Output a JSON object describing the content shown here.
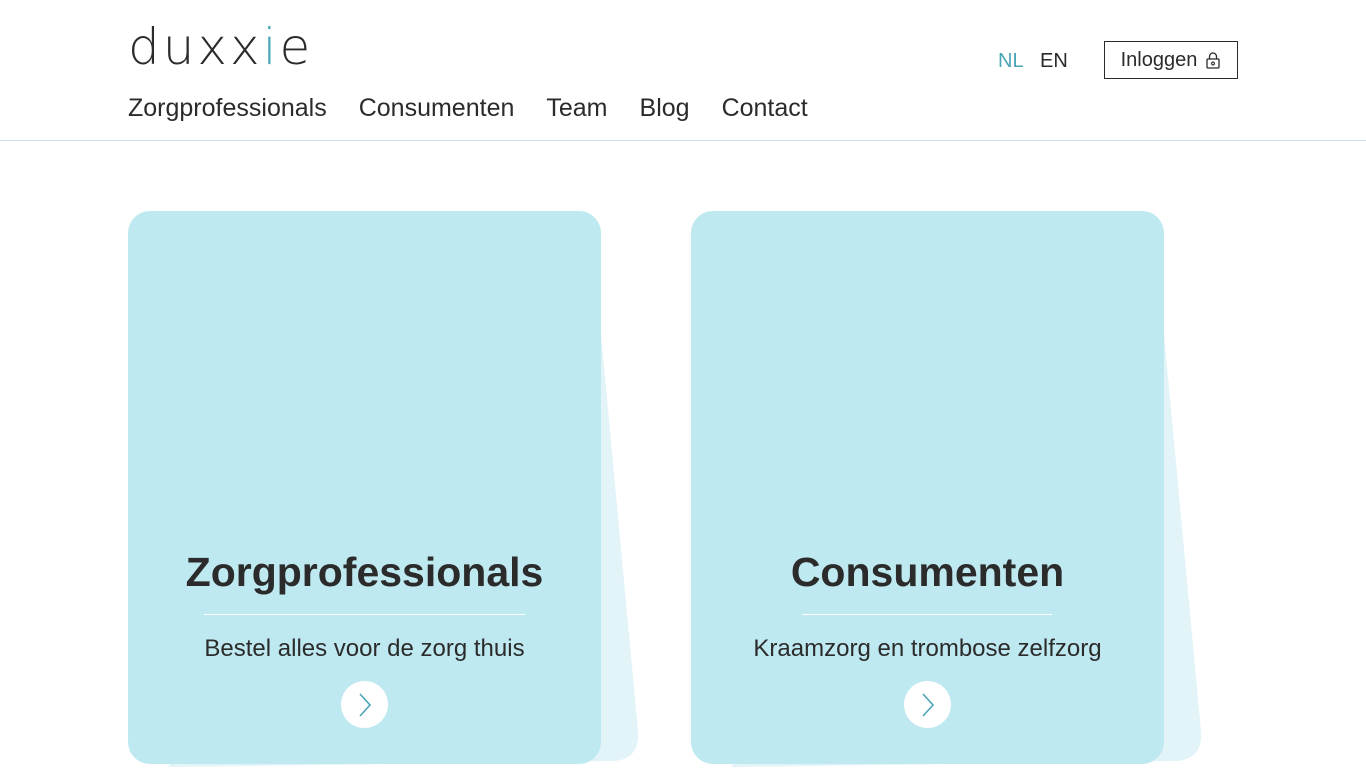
{
  "logo": {
    "text_before": "duxx",
    "text_accent": "i",
    "text_after": "e"
  },
  "nav": {
    "items": [
      {
        "label": "Zorgprofessionals"
      },
      {
        "label": "Consumenten"
      },
      {
        "label": "Team"
      },
      {
        "label": "Blog"
      },
      {
        "label": "Contact"
      }
    ]
  },
  "languages": {
    "nl": "NL",
    "en": "EN",
    "active": "NL"
  },
  "login": {
    "label": "Inloggen",
    "icon": "lock-icon"
  },
  "cards": [
    {
      "title": "Zorgprofessionals",
      "subtitle": "Bestel alles voor de zorg thuis",
      "icon": "chevron-right-icon"
    },
    {
      "title": "Consumenten",
      "subtitle": "Kraamzorg en trombose zelfzorg",
      "icon": "chevron-right-icon"
    }
  ],
  "colors": {
    "accent": "#4aa6b5",
    "card_bg": "#bfe9f0",
    "card_shadow": "#e2f4f8",
    "text": "#2b2b2b"
  }
}
